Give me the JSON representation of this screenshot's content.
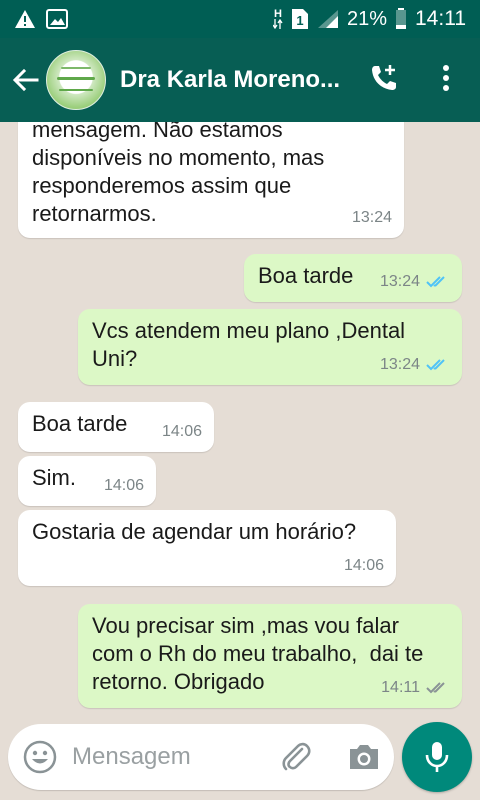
{
  "status_bar": {
    "battery": "21%",
    "time": "14:11",
    "network_label": "H"
  },
  "header": {
    "contact_name": "Dra Karla Moreno..."
  },
  "messages": [
    {
      "direction": "in",
      "text": "mensagem. Não estamos disponíveis no momento, mas responderemos assim que retornarmos.",
      "time": "13:24"
    },
    {
      "direction": "out",
      "text": "Boa tarde",
      "time": "13:24",
      "status": "read"
    },
    {
      "direction": "out",
      "text": "Vcs atendem meu plano ,Dental Uni?",
      "time": "13:24",
      "status": "read"
    },
    {
      "direction": "in",
      "text": "Boa tarde",
      "time": "14:06"
    },
    {
      "direction": "in",
      "text": "Sim.",
      "time": "14:06"
    },
    {
      "direction": "in",
      "text": "Gostaria de agendar um horário?",
      "time": "14:06"
    },
    {
      "direction": "out",
      "text": "Vou precisar sim ,mas vou falar com o Rh do meu trabalho,  dai te retorno. Obrigado",
      "time": "14:11",
      "status": "delivered"
    }
  ],
  "composer": {
    "placeholder": "Mensagem"
  },
  "colors": {
    "status_bar": "#005e54",
    "app_bar": "#075e54",
    "outgoing_bubble": "#dcf8c6",
    "incoming_bubble": "#ffffff",
    "read_tick": "#4fc3f7",
    "accent": "#00897b"
  },
  "icons": [
    "warning-icon",
    "gallery-icon",
    "sim-icon",
    "signal-icon",
    "battery-icon",
    "back-arrow-icon",
    "add-call-icon",
    "more-vert-icon",
    "emoji-icon",
    "attach-icon",
    "camera-icon",
    "mic-icon",
    "double-check-icon"
  ]
}
